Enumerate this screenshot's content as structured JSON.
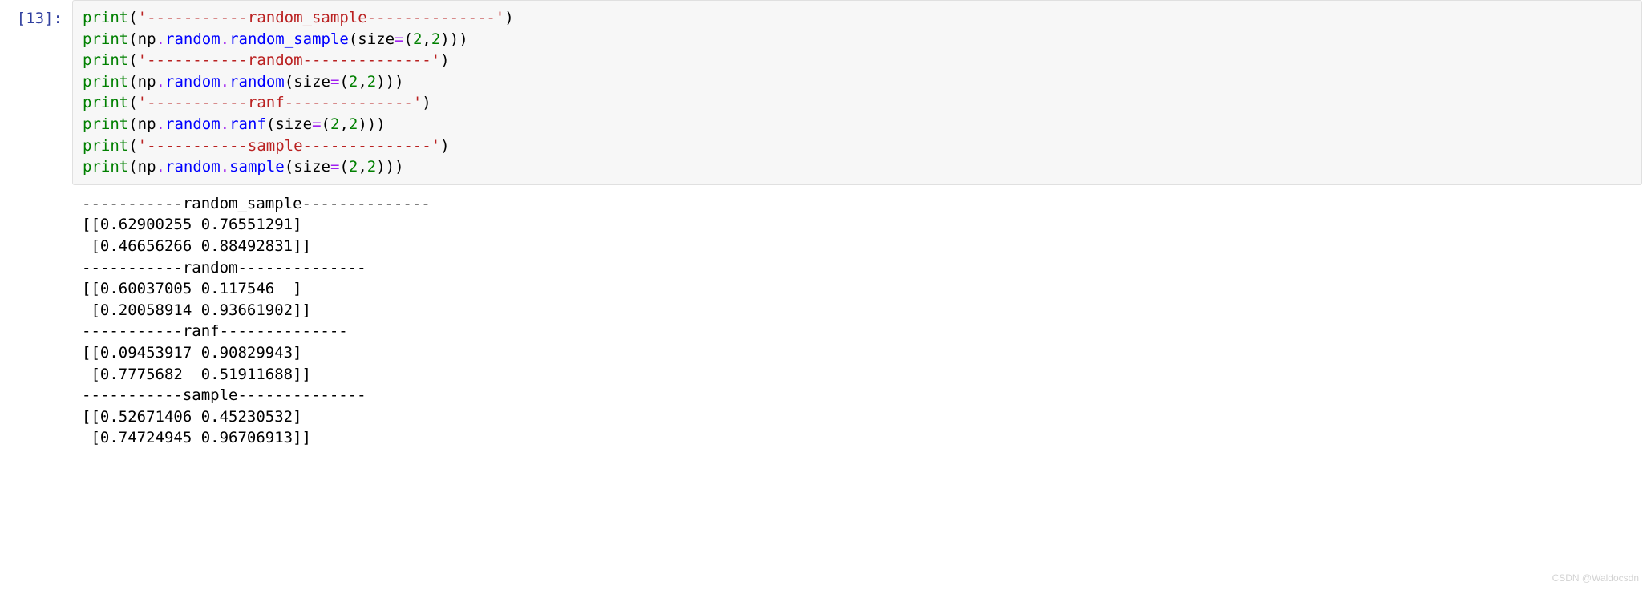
{
  "cell": {
    "prompt": "[13]:",
    "code": {
      "line1": {
        "fn": "print",
        "p1": "(",
        "str": "'-----------random_sample--------------'",
        "p2": ")"
      },
      "line2": {
        "fn": "print",
        "p1": "(",
        "var": "np",
        "dot1": ".",
        "mod": "random",
        "dot2": ".",
        "method": "random_sample",
        "p2": "(",
        "arg": "size",
        "eq": "=",
        "p3": "(",
        "n1": "2",
        "comma": ",",
        "n2": "2",
        "p4": ")",
        "p5": ")",
        "p6": ")"
      },
      "line3": {
        "fn": "print",
        "p1": "(",
        "str": "'-----------random--------------'",
        "p2": ")"
      },
      "line4": {
        "fn": "print",
        "p1": "(",
        "var": "np",
        "dot1": ".",
        "mod": "random",
        "dot2": ".",
        "method": "random",
        "p2": "(",
        "arg": "size",
        "eq": "=",
        "p3": "(",
        "n1": "2",
        "comma": ",",
        "n2": "2",
        "p4": ")",
        "p5": ")",
        "p6": ")"
      },
      "line5": {
        "fn": "print",
        "p1": "(",
        "str": "'-----------ranf--------------'",
        "p2": ")"
      },
      "line6": {
        "fn": "print",
        "p1": "(",
        "var": "np",
        "dot1": ".",
        "mod": "random",
        "dot2": ".",
        "method": "ranf",
        "p2": "(",
        "arg": "size",
        "eq": "=",
        "p3": "(",
        "n1": "2",
        "comma": ",",
        "n2": "2",
        "p4": ")",
        "p5": ")",
        "p6": ")"
      },
      "line7": {
        "fn": "print",
        "p1": "(",
        "str": "'-----------sample--------------'",
        "p2": ")"
      },
      "line8": {
        "fn": "print",
        "p1": "(",
        "var": "np",
        "dot1": ".",
        "mod": "random",
        "dot2": ".",
        "method": "sample",
        "p2": "(",
        "arg": "size",
        "eq": "=",
        "p3": "(",
        "n1": "2",
        "comma": ",",
        "n2": "2",
        "p4": ")",
        "p5": ")",
        "p6": ")"
      }
    },
    "output": "-----------random_sample--------------\n[[0.62900255 0.76551291]\n [0.46656266 0.88492831]]\n-----------random--------------\n[[0.60037005 0.117546  ]\n [0.20058914 0.93661902]]\n-----------ranf--------------\n[[0.09453917 0.90829943]\n [0.7775682  0.51911688]]\n-----------sample--------------\n[[0.52671406 0.45230532]\n [0.74724945 0.96706913]]"
  },
  "watermark": "CSDN @Waldocsdn"
}
